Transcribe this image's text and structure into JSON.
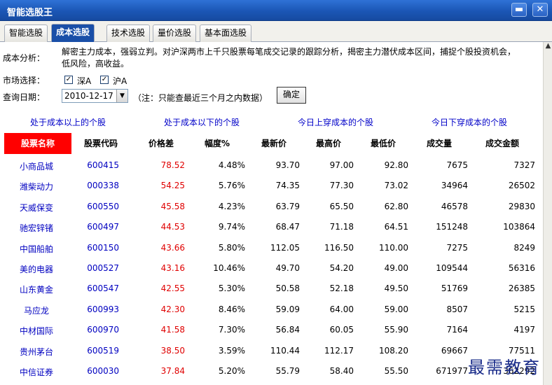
{
  "window": {
    "title": "智能选股王",
    "min_label": "▬",
    "close_label": "✕"
  },
  "tabs": [
    {
      "label": "智能选股",
      "active": false
    },
    {
      "label": "成本选股",
      "active": true
    },
    {
      "label": "技术选股",
      "active": false
    },
    {
      "label": "量价选股",
      "active": false
    },
    {
      "label": "基本面选股",
      "active": false
    }
  ],
  "analysis": {
    "label": "成本分析：",
    "line1": "解密主力成本，强弱立判。对沪深两市上千只股票每笔成交记录的跟踪分析，揭密主力潜伏成本区间，捕捉个股投资机会，",
    "line2": "低风险，高收益。"
  },
  "market": {
    "label": "市场选择：",
    "options": [
      {
        "label": "深A",
        "checked": true
      },
      {
        "label": "沪A",
        "checked": true
      }
    ]
  },
  "query": {
    "label": "查询日期：",
    "date": "2010-12-17",
    "note": "（注：只能查最近三个月之内数据）",
    "confirm": "确定"
  },
  "filters": [
    "处于成本以上的个股",
    "处于成本以下的个股",
    "今日上穿成本的个股",
    "今日下穿成本的个股"
  ],
  "table": {
    "columns": [
      "股票名称",
      "股票代码",
      "价格差",
      "幅度%",
      "最新价",
      "最高价",
      "最低价",
      "成交量",
      "成交金额"
    ],
    "rows": [
      [
        "小商品城",
        "600415",
        "78.52",
        "4.48%",
        "93.70",
        "97.00",
        "92.80",
        "7675",
        "7327"
      ],
      [
        "潍柴动力",
        "000338",
        "54.25",
        "5.76%",
        "74.35",
        "77.30",
        "73.02",
        "34964",
        "26502"
      ],
      [
        "天威保变",
        "600550",
        "45.58",
        "4.23%",
        "63.79",
        "65.50",
        "62.80",
        "46578",
        "29830"
      ],
      [
        "驰宏锌锗",
        "600497",
        "44.53",
        "9.74%",
        "68.47",
        "71.18",
        "64.51",
        "151248",
        "103864"
      ],
      [
        "中国船舶",
        "600150",
        "43.66",
        "5.80%",
        "112.05",
        "116.50",
        "110.00",
        "7275",
        "8249"
      ],
      [
        "美的电器",
        "000527",
        "43.16",
        "10.46%",
        "49.70",
        "54.20",
        "49.00",
        "109544",
        "56316"
      ],
      [
        "山东黄金",
        "600547",
        "42.55",
        "5.30%",
        "50.58",
        "52.18",
        "49.50",
        "51769",
        "26385"
      ],
      [
        "马应龙",
        "600993",
        "42.30",
        "8.46%",
        "59.09",
        "64.00",
        "59.00",
        "8507",
        "5215"
      ],
      [
        "中材国际",
        "600970",
        "41.58",
        "7.30%",
        "56.84",
        "60.05",
        "55.90",
        "7164",
        "4197"
      ],
      [
        "贵州茅台",
        "600519",
        "38.50",
        "3.59%",
        "110.44",
        "112.17",
        "108.20",
        "69667",
        "77511"
      ],
      [
        "中信证券",
        "600030",
        "37.84",
        "5.20%",
        "55.79",
        "58.40",
        "55.50",
        "671977",
        "362292"
      ]
    ]
  },
  "watermark": "最需教育"
}
